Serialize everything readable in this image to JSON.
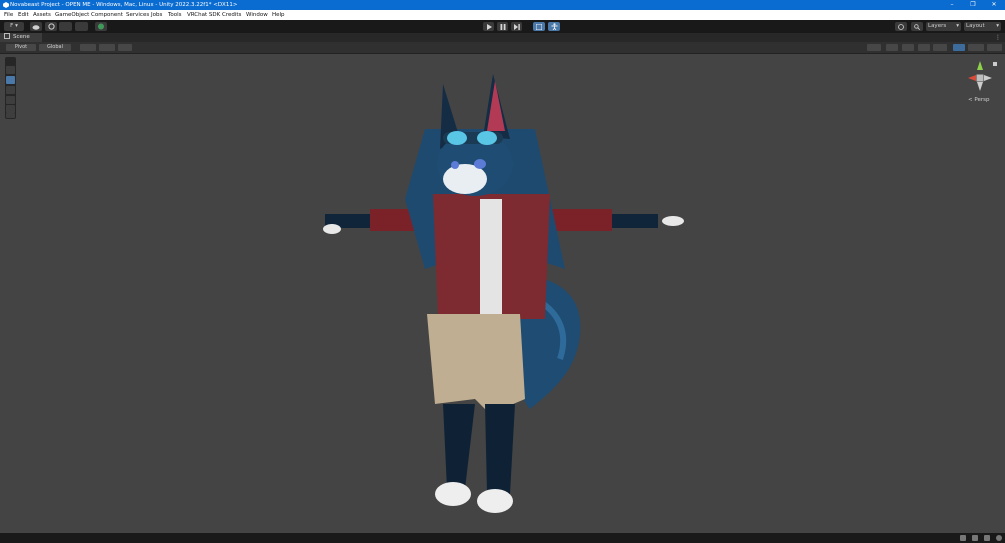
{
  "window": {
    "title": "Novabeast Project - OPEN ME - Windows, Mac, Linux - Unity 2022.3.22f1* <DX11>",
    "controls": [
      "–",
      "❐",
      "✕"
    ]
  },
  "menu": [
    "File",
    "Edit",
    "Assets",
    "GameObject",
    "Component",
    "Services",
    "Jobs",
    "Tools",
    "VRChat SDK",
    "Credits",
    "Window",
    "Help"
  ],
  "toolbar": {
    "account_label": "F ▾",
    "play_icon": "play-icon",
    "layers_label": "Layers",
    "layout_label": "Layout"
  },
  "scene": {
    "tab_label": "Scene",
    "pivot_label": "Pivot",
    "global_label": "Global",
    "persp_label": "< Persp"
  },
  "colors": {
    "title_bar": "#0a6cd1",
    "accent": "#4a78a8"
  }
}
